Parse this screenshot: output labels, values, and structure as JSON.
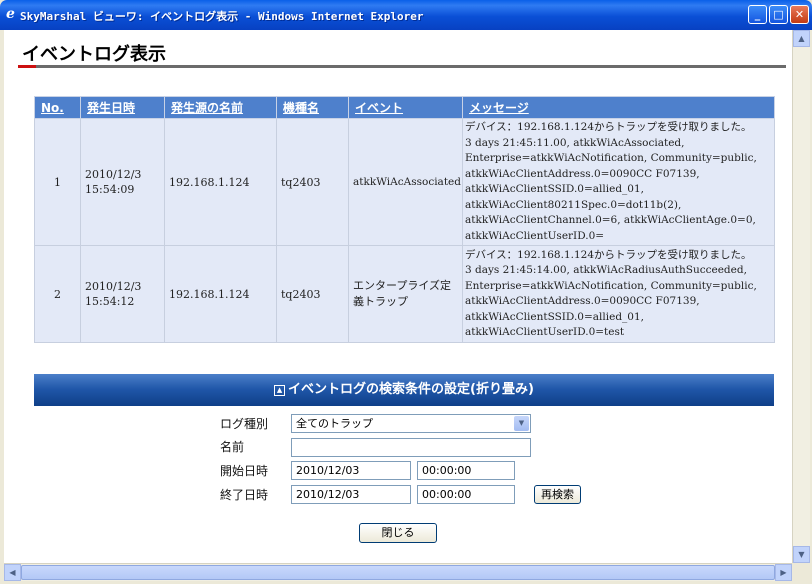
{
  "window": {
    "title": "SkyMarshal ビューワ: イベントログ表示 - Windows Internet Explorer",
    "minimize": "_",
    "maximize": "□",
    "close": "✕"
  },
  "page": {
    "title": "イベントログ表示"
  },
  "table": {
    "headers": [
      "No.",
      "発生日時",
      "発生源の名前",
      "機種名",
      "イベント",
      "メッセージ"
    ],
    "rows": [
      {
        "no": "1",
        "date": "2010/12/3",
        "time": "15:54:09",
        "source": "192.168.1.124",
        "model": "tq2403",
        "event": "atkkWiAcAssociated",
        "message": [
          "デバイス：192.168.1.124からトラップを受け取りました。",
          "3 days 21:45:11.00, atkkWiAcAssociated,",
          "Enterprise=atkkWiAcNotification, Community=public,",
          "atkkWiAcClientAddress.0=0090CC F07139,",
          "atkkWiAcClientSSID.0=allied_01,",
          "atkkWiAcClient80211Spec.0=dot11b(2),",
          "atkkWiAcClientChannel.0=6, atkkWiAcClientAge.0=0,",
          "atkkWiAcClientUserID.0="
        ]
      },
      {
        "no": "2",
        "date": "2010/12/3",
        "time": "15:54:12",
        "source": "192.168.1.124",
        "model": "tq2403",
        "event": "エンタープライズ定義トラップ",
        "message": [
          "デバイス：192.168.1.124からトラップを受け取りました。",
          "3 days 21:45:14.00, atkkWiAcRadiusAuthSucceeded,",
          "Enterprise=atkkWiAcNotification, Community=public,",
          "atkkWiAcClientAddress.0=0090CC F07139,",
          "atkkWiAcClientSSID.0=allied_01,",
          "atkkWiAcClientUserID.0=test"
        ]
      }
    ]
  },
  "search": {
    "header": "イベントログの検索条件の設定(折り畳み)",
    "collapse_icon": "chevron-up-icon",
    "log_type_label": "ログ種別",
    "log_type_value": "全てのトラップ",
    "name_label": "名前",
    "name_value": "",
    "start_label": "開始日時",
    "start_date": "2010/12/03",
    "start_time": "00:00:00",
    "end_label": "終了日時",
    "end_date": "2010/12/03",
    "end_time": "00:00:00",
    "research_button": "再検索",
    "close_button": "閉じる"
  },
  "colors": {
    "accent_red": "#cc1010",
    "header_blue": "#4e80cc",
    "row_bg": "#e3e9f7"
  }
}
